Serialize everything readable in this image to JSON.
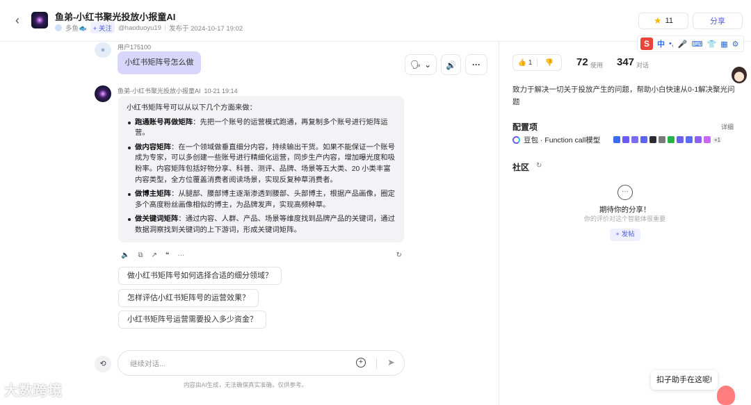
{
  "header": {
    "title": "鱼弟-小红书聚光投放小报童AI",
    "author": "多鱼🐟",
    "follow_label": "+ 关注",
    "handle": "@haoduoyu19",
    "published": "发布于 2024-10-17 19:02",
    "favorites_count": "11",
    "share_label": "分享"
  },
  "ime_toolbar": {
    "logo": "S",
    "mode": "中"
  },
  "conversation": {
    "user_name": "用户175100",
    "user_message": "小红书矩阵号怎么做",
    "bot_name": "鱼弟-小红书聚光投放小报童AI",
    "bot_time": "10-21 19:14",
    "answer_intro": "小红书矩阵号可以从以下几个方面来做：",
    "points": [
      {
        "title": "跑通账号再做矩阵",
        "text": "：先把一个账号的运营模式跑通，再复制多个账号进行矩阵运营。"
      },
      {
        "title": "做内容矩阵",
        "text": "：在一个领域做垂直细分内容，持续输出干货。如果不能保证一个账号成为专家，可以多创建一些账号进行精细化运营，同步生产内容，增加曝光度和吸粉率。内容矩阵包括好物分享、科普、测评、品牌、场景等五大类、20 小类丰富内容类型，全方位覆盖消费者阅读场景，实现反复种草消费者。"
      },
      {
        "title": "做博主矩阵",
        "text": "：从腿部、腰部博主逐渐渗透到腰部、头部博主，根据产品画像，圈定多个高度粉丝画像相似的博主，为品牌发声，实现高频种草。"
      },
      {
        "title": "做关键词矩阵",
        "text": "：通过内容、人群、产品、场景等维度找到品牌产品的关键词，通过数据洞察找到关键词的上下游词，形成关键词矩阵。"
      }
    ],
    "suggestions": [
      "做小红书矩阵号如何选择合适的细分领域？",
      "怎样评估小红书矩阵号的运营效果？",
      "小红书矩阵号运营需要投入多少资金？"
    ],
    "input_placeholder": "继续对话...",
    "disclaimer": "内容由AI生成，无法确保真实准确，仅供参考。"
  },
  "watermark": "大数跨境",
  "panel": {
    "like_count": "1",
    "uses_count": "72",
    "uses_label": "使用",
    "conversations_count": "347",
    "conversations_label": "对话",
    "description": "致力于解决一切关于投放产生的问题，帮助小白快速从0-1解决聚光问题",
    "config_title": "配置项",
    "detail_label": "详细",
    "model_name": "豆包 · Function call模型",
    "plugins_more": "+1",
    "community_title": "社区",
    "empty_title": "期待你的分享！",
    "empty_subtitle": "你的评价对这个智能体很重要",
    "post_label": "+ 发帖"
  },
  "helper": {
    "tip": "扣子助手在这呢!"
  },
  "colors": {
    "accent": "#4e5ce6",
    "user_bubble": "#d8d7fb",
    "bot_bubble": "#f3f3f5"
  }
}
